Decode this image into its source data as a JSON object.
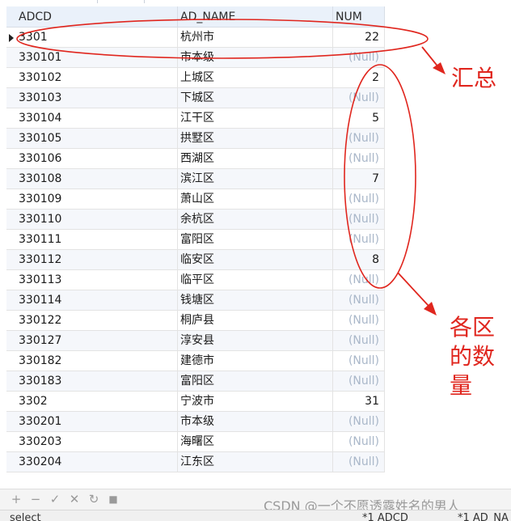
{
  "columns": [
    "ADCD",
    "AD_NAME",
    "NUM"
  ],
  "rows": [
    [
      "3301",
      "杭州市",
      "22"
    ],
    [
      "330101",
      "市本级",
      "(Null)"
    ],
    [
      "330102",
      "上城区",
      "2"
    ],
    [
      "330103",
      "下城区",
      "(Null)"
    ],
    [
      "330104",
      "江干区",
      "5"
    ],
    [
      "330105",
      "拱墅区",
      "(Null)"
    ],
    [
      "330106",
      "西湖区",
      "(Null)"
    ],
    [
      "330108",
      "滨江区",
      "7"
    ],
    [
      "330109",
      "萧山区",
      "(Null)"
    ],
    [
      "330110",
      "余杭区",
      "(Null)"
    ],
    [
      "330111",
      "富阳区",
      "(Null)"
    ],
    [
      "330112",
      "临安区",
      "8"
    ],
    [
      "330113",
      "临平区",
      "(Null)"
    ],
    [
      "330114",
      "钱塘区",
      "(Null)"
    ],
    [
      "330122",
      "桐庐县",
      "(Null)"
    ],
    [
      "330127",
      "淳安县",
      "(Null)"
    ],
    [
      "330182",
      "建德市",
      "(Null)"
    ],
    [
      "330183",
      "富阳区",
      "(Null)"
    ],
    [
      "3302",
      "宁波市",
      "31"
    ],
    [
      "330201",
      "市本级",
      "(Null)"
    ],
    [
      "330203",
      "海曙区",
      "(Null)"
    ],
    [
      "330204",
      "江东区",
      "(Null)"
    ]
  ],
  "annotations": {
    "summary": "汇总",
    "district_line1": "各区",
    "district_line2": "的数",
    "district_line3": "量",
    "color": "#e0261e"
  },
  "toolbar": {
    "add_icon": "+",
    "delete_icon": "−",
    "apply_icon": "✓",
    "cancel_icon": "✕",
    "refresh_icon": "↻",
    "stop_icon": "■"
  },
  "status": {
    "query": "select",
    "field1": "*1 ADCD",
    "field2": "*1 AD_NA"
  },
  "watermark": "CSDN @一个不愿透露姓名的男人"
}
